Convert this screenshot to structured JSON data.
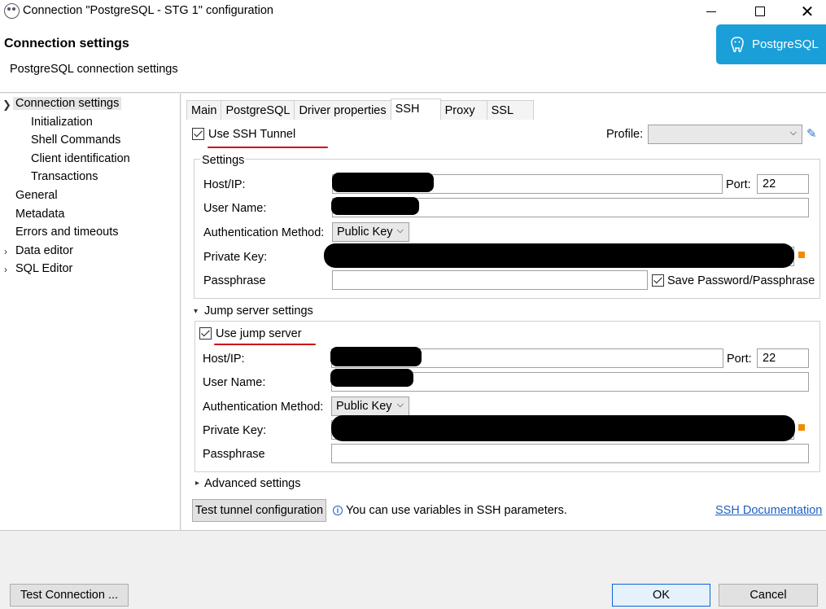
{
  "window": {
    "title": "Connection \"PostgreSQL - STG 1\" configuration",
    "minimize_icon": "minimize-icon",
    "maximize_icon": "maximize-icon",
    "close_glyph": "✕"
  },
  "header": {
    "title": "Connection settings",
    "subtitle": "PostgreSQL connection settings",
    "brand": "PostgreSQL",
    "brand_color": "#1a9fd8"
  },
  "tree": {
    "items": [
      {
        "label": "Connection settings",
        "expanded": true,
        "selected": true
      },
      {
        "label": "Initialization"
      },
      {
        "label": "Shell Commands"
      },
      {
        "label": "Client identification"
      },
      {
        "label": "Transactions"
      },
      {
        "label": "General"
      },
      {
        "label": "Metadata"
      },
      {
        "label": "Errors and timeouts"
      },
      {
        "label": "Data editor",
        "expandable": true
      },
      {
        "label": "SQL Editor",
        "expandable": true
      }
    ]
  },
  "tabs": [
    "Main",
    "PostgreSQL",
    "Driver properties",
    "SSH",
    "Proxy",
    "SSL"
  ],
  "active_tab": "SSH",
  "ssh": {
    "use_tunnel_label": "Use SSH Tunnel",
    "use_tunnel_checked": true,
    "profile_label": "Profile:",
    "profile_value": "",
    "settings_group": "Settings",
    "host_label": "Host/IP:",
    "port_label": "Port:",
    "port_value": "22",
    "user_label": "User Name:",
    "auth_label": "Authentication Method:",
    "auth_value": "Public Key",
    "key_label": "Private Key:",
    "pass_label": "Passphrase",
    "save_pass_label": "Save Password/Passphrase",
    "save_pass_checked": true
  },
  "jump": {
    "section_label": "Jump server settings",
    "use_label": "Use jump server",
    "use_checked": true,
    "host_label": "Host/IP:",
    "port_label": "Port:",
    "port_value": "22",
    "user_label": "User Name:",
    "auth_label": "Authentication Method:",
    "auth_value": "Public Key",
    "key_label": "Private Key:",
    "pass_label": "Passphrase"
  },
  "advanced_label": "Advanced settings",
  "test_tunnel_label": "Test tunnel configuration",
  "info_text": "You can use variables in SSH parameters.",
  "doc_link": "SSH Documentation",
  "footer": {
    "test_connection": "Test Connection ...",
    "ok": "OK",
    "cancel": "Cancel"
  },
  "colors": {
    "annotation_red": "#d0021b",
    "accent": "#0a64d8"
  }
}
